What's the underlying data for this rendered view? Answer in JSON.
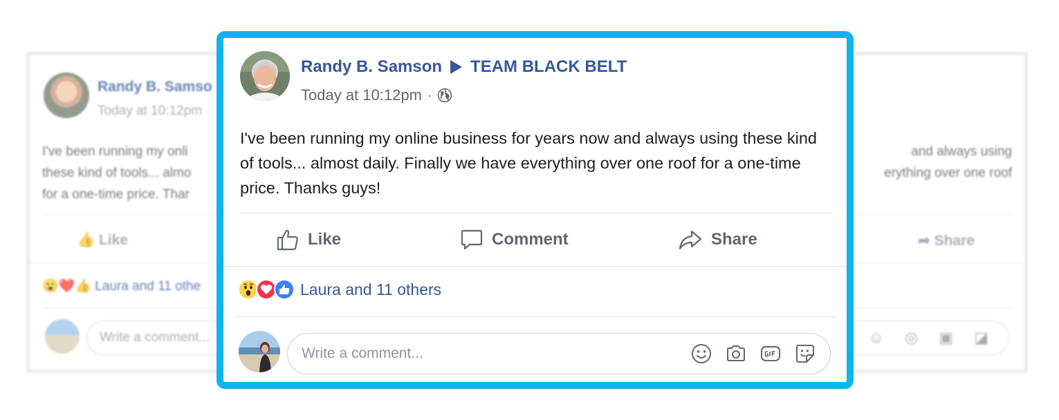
{
  "post": {
    "author": "Randy B. Samson",
    "group": "TEAM BLACK BELT",
    "time": "Today at 10:12pm",
    "meta_separator": "·",
    "privacy_icon": "globe-icon",
    "text": "I've been running my online business for years now and always using these kind of tools... almost daily. Finally we have everything over one roof for a one-time price. Thanks guys!"
  },
  "actions": {
    "like_label": "Like",
    "comment_label": "Comment",
    "share_label": "Share"
  },
  "reactions": {
    "icons": [
      "wow-icon",
      "love-icon",
      "like-icon"
    ],
    "summary": "Laura and 11 others"
  },
  "comment_box": {
    "placeholder": "Write a comment...",
    "icons": [
      "emoji-icon",
      "camera-icon",
      "gif-icon",
      "sticker-icon"
    ]
  },
  "background_card": {
    "author_partial": "Randy B. Samso",
    "time": "Today at 10:12pm",
    "text_left": [
      "I've been running my onli",
      "these kind of tools... almo",
      "for a one-time price. Thar"
    ],
    "text_right": [
      "and always using",
      "erything over one roof"
    ],
    "like_label": "Like",
    "share_label": "Share",
    "reaction_summary_partial": "Laura and 11 othe",
    "comment_placeholder_partial": "Write a comment..."
  },
  "colors": {
    "frame_accent": "#12b3ea",
    "link_blue": "#365899",
    "action_gray": "#606770",
    "love_red": "#f0334f",
    "like_blue": "#3b82f6",
    "wow_yellow": "#fcd34d"
  }
}
